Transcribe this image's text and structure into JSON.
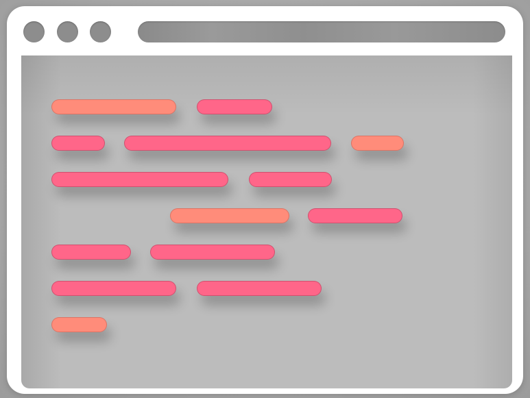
{
  "window": {
    "controls": [
      "close-dot",
      "minimize-dot",
      "maximize-dot"
    ],
    "address_bar": ""
  },
  "colors": {
    "pink": "#ff6689",
    "salmon": "#ff8c7a",
    "window_frame": "#ffffff",
    "content_bg": "#bcbcbc"
  },
  "code_lines": [
    {
      "tokens": [
        "salmon",
        "pink"
      ]
    },
    {
      "tokens": [
        "pink",
        "pink",
        "salmon"
      ]
    },
    {
      "tokens": [
        "pink",
        "pink"
      ]
    },
    {
      "tokens": [
        "salmon",
        "pink"
      ]
    },
    {
      "tokens": [
        "pink",
        "pink"
      ]
    },
    {
      "tokens": [
        "pink",
        "pink"
      ]
    },
    {
      "tokens": [
        "salmon"
      ]
    }
  ]
}
